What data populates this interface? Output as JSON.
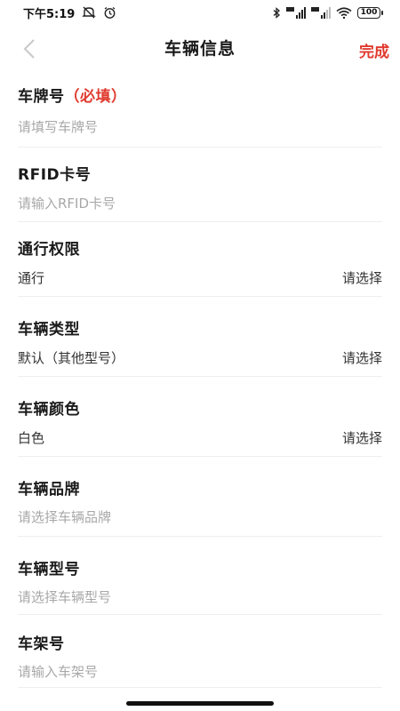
{
  "status_bar": {
    "time": "下午5:19",
    "battery": "100"
  },
  "nav": {
    "title": "车辆信息",
    "done_label": "完成"
  },
  "fields": [
    {
      "label": "车牌号",
      "required_tag": "（必填）",
      "placeholder": "请填写车牌号"
    },
    {
      "label": "RFID卡号",
      "placeholder": "请输入RFID卡号"
    },
    {
      "label": "通行权限",
      "value": "通行",
      "picker_hint": "请选择"
    },
    {
      "label": "车辆类型",
      "value": "默认（其他型号）",
      "picker_hint": "请选择"
    },
    {
      "label": "车辆颜色",
      "value": "白色",
      "picker_hint": "请选择"
    },
    {
      "label": "车辆品牌",
      "placeholder": "请选择车辆品牌"
    },
    {
      "label": "车辆型号",
      "placeholder": "请选择车辆型号"
    },
    {
      "label": "车架号",
      "placeholder": "请输入车架号"
    }
  ],
  "colors": {
    "accent": "#e03a2f",
    "placeholder": "#a8a8a8",
    "divider": "#eeeeee"
  }
}
